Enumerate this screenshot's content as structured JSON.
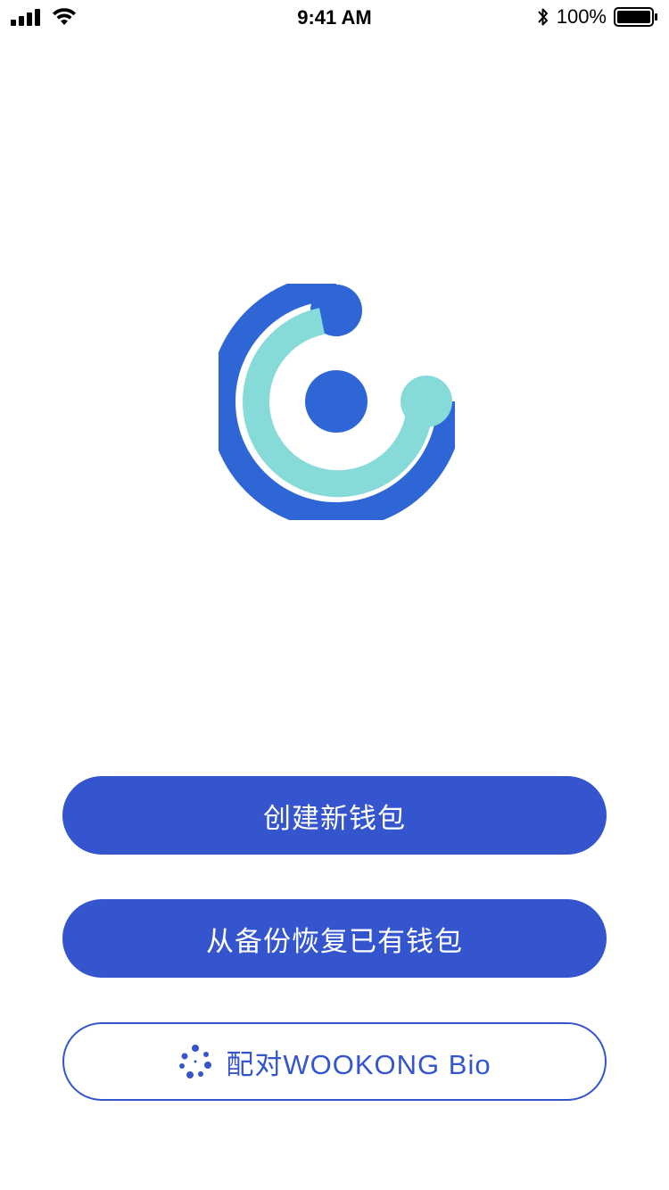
{
  "status_bar": {
    "time": "9:41 AM",
    "battery_percent": "100%",
    "icons": [
      "cellular-signal-icon",
      "wifi-icon",
      "bluetooth-icon",
      "battery-icon"
    ]
  },
  "logo": {
    "icon": "wallet-logo-icon",
    "colors": {
      "outer": "#2f66d6",
      "inner": "#86dbd9",
      "dot": "#2f66d6"
    }
  },
  "actions": {
    "create_label": "创建新钱包",
    "restore_label": "从备份恢复已有钱包",
    "pair_label": "配对WOOKONG Bio",
    "pair_icon": "device-pair-icon"
  },
  "colors": {
    "primary": "#3455cd",
    "background": "#ffffff"
  }
}
